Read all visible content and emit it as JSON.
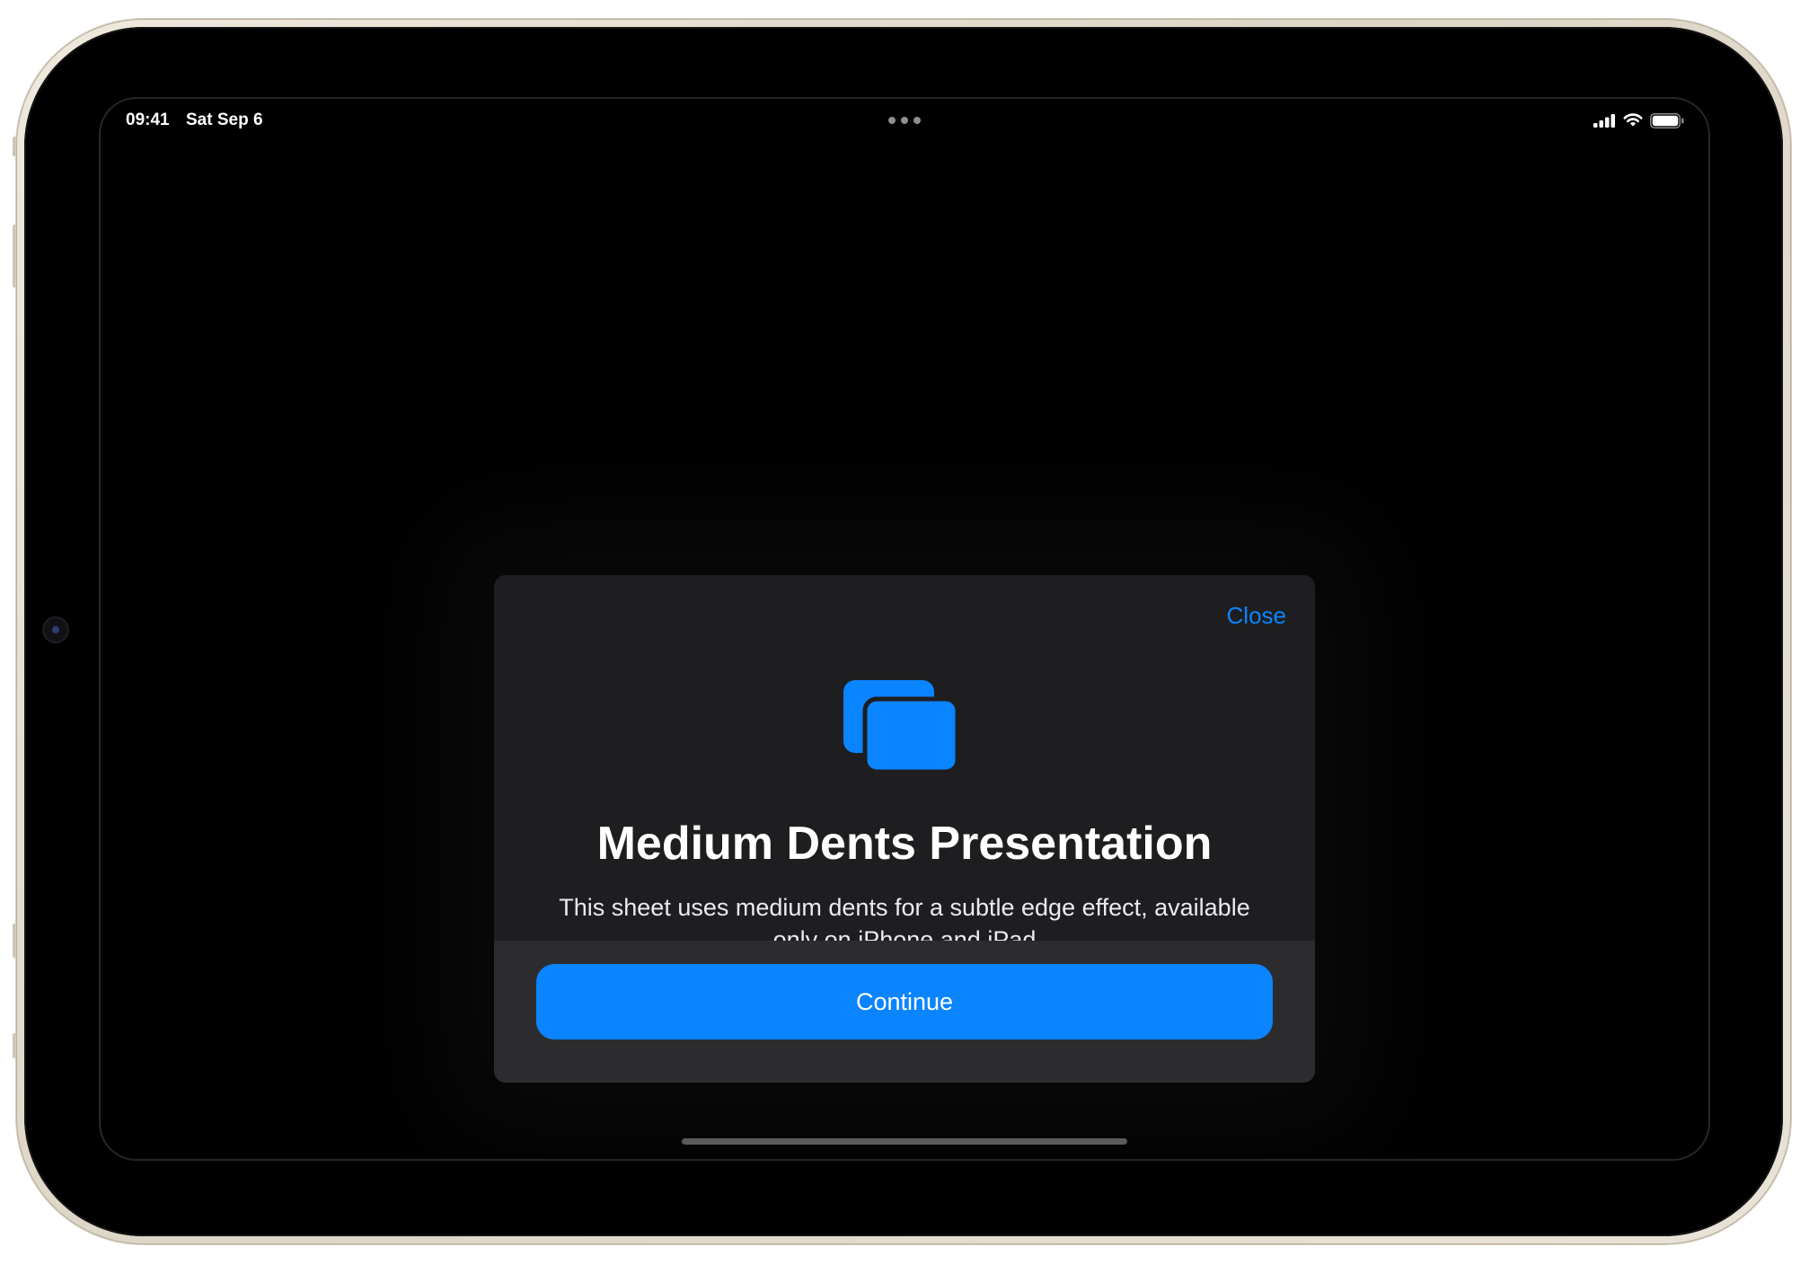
{
  "status_bar": {
    "time": "09:41",
    "date": "Sat Sep 6",
    "cellular_bars": 4,
    "cellular_bars_max": 4,
    "wifi_bars": 3,
    "battery_level": 1.0
  },
  "sheet": {
    "close_label": "Close",
    "title": "Medium Dents Presentation",
    "description": "This sheet uses medium dents for a subtle edge effect, available only on iPhone and iPad",
    "continue_label": "Continue"
  },
  "icons": {
    "cellular": "cellular-signal-icon",
    "wifi": "wifi-icon",
    "battery": "battery-icon",
    "multitasking": "multitasking-dots-icon",
    "sheet_symbol": "rectangle-stack-icon",
    "camera": "front-camera-icon"
  },
  "colors": {
    "accent": "#0a84ff",
    "sheet_background": "#1e1e20",
    "footer_background": "#2c2c2e",
    "screen_background": "#000000",
    "device_frame": "#e4ddcf",
    "home_indicator": "#5b5b5e"
  }
}
